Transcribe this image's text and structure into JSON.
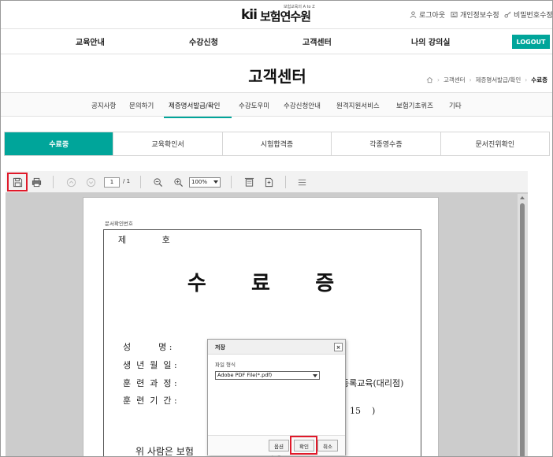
{
  "header": {
    "logo_mark": "kii",
    "logo_name": "보험연수원",
    "logo_tag": "보험교육의 A to Z",
    "utility": [
      {
        "label": "로그아웃",
        "icon": "person-icon"
      },
      {
        "label": "개인정보수정",
        "icon": "profile-card-icon"
      },
      {
        "label": "비밀번호수정",
        "icon": "key-icon"
      }
    ]
  },
  "gnb": {
    "items": [
      "교육안내",
      "수강신청",
      "고객센터",
      "나의 강의실"
    ],
    "logout_label": "LOGOUT",
    "accent": "#00a59a"
  },
  "page": {
    "title": "고객센터",
    "breadcrumb": [
      "고객센터",
      "제증명서발급/확인",
      "수료증"
    ]
  },
  "subnav": {
    "items": [
      "공지사항",
      "문의하기",
      "제증명서발급/확인",
      "수강도우미",
      "수강신청안내",
      "원격지원서비스",
      "보험기초퀴즈",
      "기타"
    ],
    "active": "제증명서발급/확인"
  },
  "tabs": {
    "items": [
      "수료증",
      "교육확인서",
      "시험합격증",
      "각종영수증",
      "문서진위확인"
    ],
    "active": "수료증"
  },
  "viewer": {
    "page_current": "1",
    "page_total": "/ 1",
    "zoom": "100%"
  },
  "certificate": {
    "doc_number_label": "문서확인번호",
    "no_label": "제             호",
    "title": "수     료     증",
    "rows": [
      {
        "label": "성          명 :",
        "value": ""
      },
      {
        "label": "생  년  월  일 :",
        "value": ""
      },
      {
        "label": "훈  련  과  정 :",
        "value": "등록교육(대리점)"
      },
      {
        "label": "훈  련  기  간 :",
        "value": "15    )"
      }
    ],
    "body_text": "위 사람은 보험                        과정을"
  },
  "dialog": {
    "title": "저장",
    "close": "×",
    "format_label": "파일 형식",
    "format_value": "Adobe PDF File(*.pdf)",
    "buttons": {
      "options": "옵션",
      "ok": "확인",
      "cancel": "취소"
    }
  }
}
